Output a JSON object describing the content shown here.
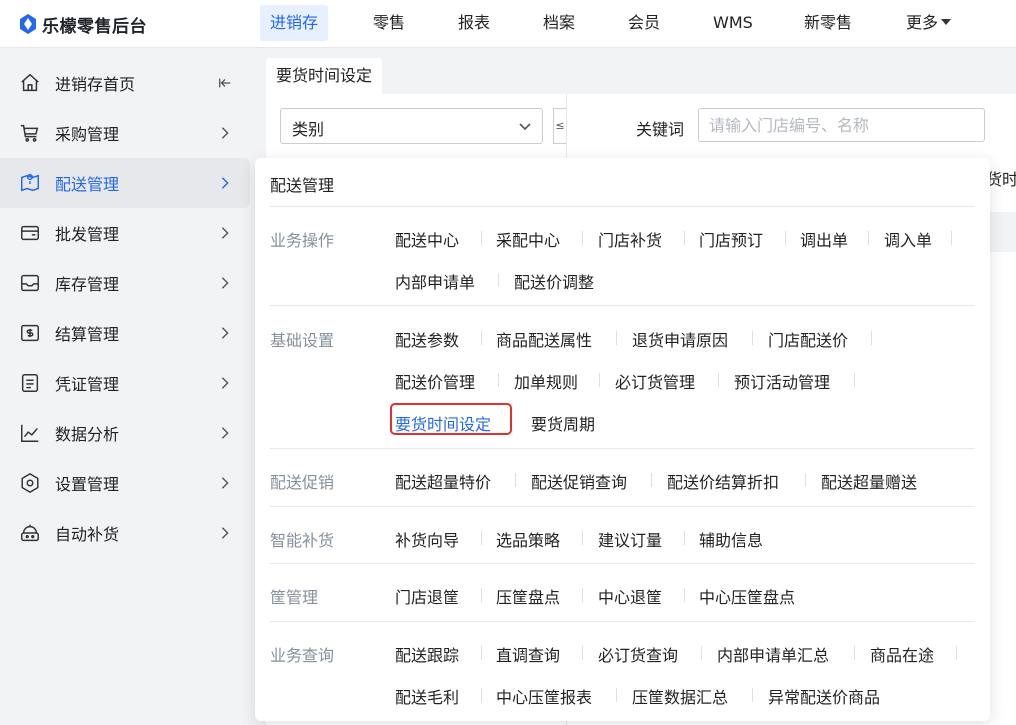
{
  "app": {
    "title": "乐檬零售后台"
  },
  "topnav": [
    {
      "label": "进销存",
      "active": true
    },
    {
      "label": "零售"
    },
    {
      "label": "报表"
    },
    {
      "label": "档案"
    },
    {
      "label": "会员"
    },
    {
      "label": "WMS"
    },
    {
      "label": "新零售"
    },
    {
      "label": "更多"
    }
  ],
  "sidebar": {
    "items": [
      {
        "label": "进销存首页",
        "icon": "home-icon"
      },
      {
        "label": "采购管理",
        "icon": "cart-icon"
      },
      {
        "label": "配送管理",
        "icon": "map-icon",
        "active": true
      },
      {
        "label": "批发管理",
        "icon": "wallet-icon"
      },
      {
        "label": "库存管理",
        "icon": "inbox-icon"
      },
      {
        "label": "结算管理",
        "icon": "money-icon"
      },
      {
        "label": "凭证管理",
        "icon": "document-icon"
      },
      {
        "label": "数据分析",
        "icon": "chart-icon"
      },
      {
        "label": "设置管理",
        "icon": "settings-icon"
      },
      {
        "label": "自动补货",
        "icon": "robot-icon"
      }
    ]
  },
  "main": {
    "tab_label": "要货时间设定",
    "category_select": "类别",
    "split_handle": "≤",
    "keyword_label": "关键词",
    "keyword_placeholder": "请输入门店编号、名称",
    "clipped_header": "货时"
  },
  "mega": {
    "title": "配送管理",
    "current": "要货时间设定",
    "sections": [
      {
        "label": "业务操作",
        "items": [
          "配送中心",
          "采配中心",
          "门店补货",
          "门店预订",
          "调出单",
          "调入单",
          "内部申请单",
          "配送价调整"
        ]
      },
      {
        "label": "基础设置",
        "items": [
          "配送参数",
          "商品配送属性",
          "退货申请原因",
          "门店配送价",
          "配送价管理",
          "加单规则",
          "必订货管理",
          "预订活动管理",
          "要货时间设定",
          "要货周期"
        ]
      },
      {
        "label": "配送促销",
        "items": [
          "配送超量特价",
          "配送促销查询",
          "配送价结算折扣",
          "配送超量赠送"
        ]
      },
      {
        "label": "智能补货",
        "items": [
          "补货向导",
          "选品策略",
          "建议订量",
          "辅助信息"
        ]
      },
      {
        "label": "筐管理",
        "items": [
          "门店退筐",
          "压筐盘点",
          "中心退筐",
          "中心压筐盘点"
        ]
      },
      {
        "label": "业务查询",
        "items": [
          "配送跟踪",
          "直调查询",
          "必订货查询",
          "内部申请单汇总",
          "商品在途",
          "配送毛利",
          "中心压筐报表",
          "压筐数据汇总",
          "异常配送价商品"
        ]
      }
    ]
  },
  "colors": {
    "accent": "#2468f2",
    "highlight": "#e0322c"
  }
}
